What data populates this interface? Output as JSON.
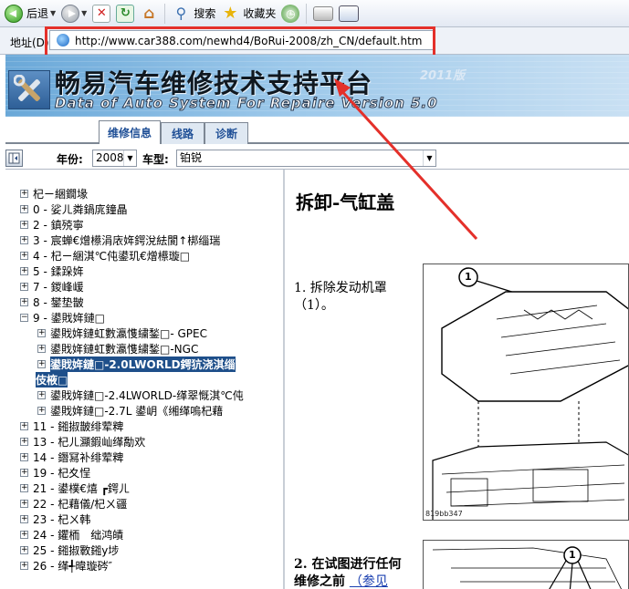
{
  "toolbar": {
    "back_label": "后退",
    "search_label": "搜索",
    "favorites_label": "收藏夹"
  },
  "address": {
    "label": "地址(D)",
    "url": "http://www.car388.com/newhd4/BoRui-2008/zh_CN/default.htm"
  },
  "banner": {
    "title": "畅易汽车维修技术支持平台",
    "edition": "2011版",
    "subtitle": "Data of Auto System For Repaire Version 5.0"
  },
  "tabs": [
    {
      "label": "维修信息",
      "active": true
    },
    {
      "label": "线路",
      "active": false
    },
    {
      "label": "诊断",
      "active": false
    }
  ],
  "filter": {
    "year_label": "年份:",
    "year_value": "2008",
    "model_label": "车型:",
    "model_value": "铂锐"
  },
  "tree": {
    "items": [
      {
        "text": "杞ㄧ綑鐗堟",
        "expander": "+"
      },
      {
        "text": "0 - 娑ㄦ粦鍋庣鐘瞐",
        "expander": "+"
      },
      {
        "text": "2 - 鎮殑寧",
        "expander": "+"
      },
      {
        "text": "3 - 宸蝉€熷櫒涓庡姩鍔涗紶閬↑梆缁瑞",
        "expander": "+"
      },
      {
        "text": "4 - 杞ㄧ綑淇℃伅鍙玑€熷櫒璇□",
        "expander": "+"
      },
      {
        "text": "5 - 鍒跺姩",
        "expander": "+"
      },
      {
        "text": "7 - 鍐峰嵈",
        "expander": "+"
      },
      {
        "text": "8 - 鐢垫皵",
        "expander": "+"
      },
      {
        "text": "9 - 鍙戝姩鏈□",
        "expander": "−"
      },
      {
        "text": "鍙戝姩鏈虹數瀛愯繍鍫□- GPEC",
        "expander": "+"
      },
      {
        "text": "鍙戝姩鏈虹數瀛愯繍鍫□-NGC",
        "expander": "+"
      },
      {
        "text": "鍙戝姩鏈□-2.0LWORLD鍔犺浇淇缁",
        "expander": "+"
      },
      {
        "text": "伎棭□",
        "expander": ""
      },
      {
        "text": "鍙戝姩鏈□-2.4LWORLD-缂翠慨淇℃伅",
        "expander": "+"
      },
      {
        "text": "鍙戝姩鏈□-2.7L 鍙岄《缃缂嗚杞藉",
        "expander": "+"
      },
      {
        "text": "11 - 鎺掓皵绯荤粺",
        "expander": "+"
      },
      {
        "text": "13 - 杞ㄦ灦鍜屾缂勪欢",
        "expander": "+"
      },
      {
        "text": "14 - 鐕冩补绯荤粺",
        "expander": "+"
      },
      {
        "text": "19 - 杞夊悜",
        "expander": "+"
      },
      {
        "text": "21 - 鍙樸€熺 ┏鍔ㄦ",
        "expander": "+"
      },
      {
        "text": "22 - 杞藉儀/杞ㄨ疆",
        "expander": "+"
      },
      {
        "text": "23 - 杞ㄨ韩",
        "expander": "+"
      },
      {
        "text": "24 - 鑺栭　绌鸿皟",
        "expander": "+"
      },
      {
        "text": "25 - 鎺掓斁鎺у埗",
        "expander": "+"
      },
      {
        "text": "26 - 缂╃暐璇硶″",
        "expander": "+"
      }
    ]
  },
  "content": {
    "heading": "拆卸-气缸盖",
    "step1_line1": "1. 拆除发动机罩",
    "step1_line2": "（1）。",
    "figure1_callout": "1",
    "figure1_caption": "819bb347",
    "step2_line1": "2. 在试图进行任何",
    "step2_line2": "维修之前",
    "step2_link": "（参见",
    "figure2_callout": "1"
  },
  "colors": {
    "annotation": "#e4302a",
    "tab_text": "#1f4f96",
    "selected_bg": "#1e4f8a"
  }
}
